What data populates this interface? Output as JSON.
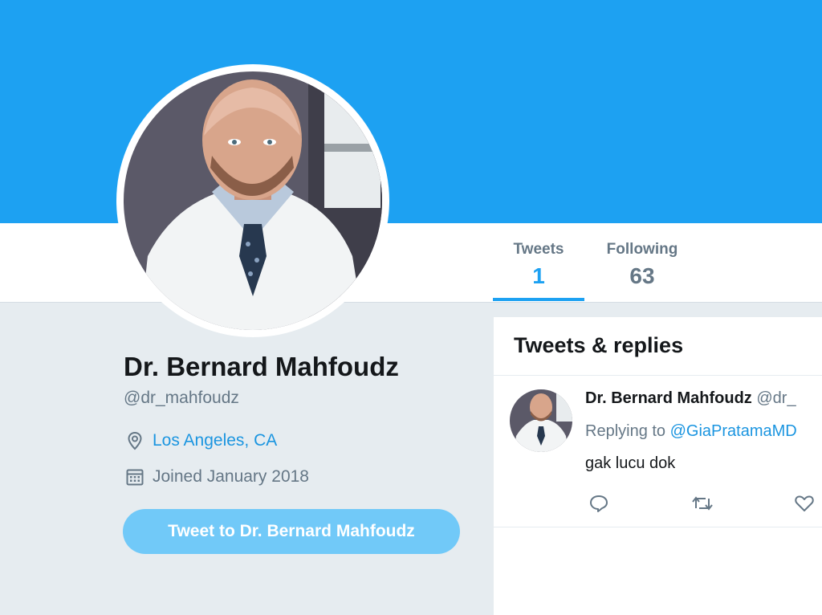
{
  "profile": {
    "name": "Dr. Bernard Mahfoudz",
    "handle": "@dr_mahfoudz",
    "location": "Los Angeles, CA",
    "joined": "Joined January 2018",
    "tweet_to_label": "Tweet to Dr. Bernard Mahfoudz"
  },
  "stats": {
    "tweets_label": "Tweets",
    "tweets_count": "1",
    "following_label": "Following",
    "following_count": "63"
  },
  "timeline": {
    "title": "Tweets & replies",
    "tweet": {
      "author_name": "Dr. Bernard Mahfoudz",
      "author_handle": "@dr_",
      "reply_prefix": "Replying to",
      "reply_mention": "@GiaPratamaMD",
      "text": "gak lucu dok",
      "actions": [
        "reply-icon",
        "retweet-icon",
        "like-icon"
      ]
    }
  },
  "colors": {
    "banner": "#1da1f2",
    "accent": "#1da1f2",
    "link": "#1b95e0",
    "button": "#71c9f8",
    "background": "#e6ecf0"
  },
  "icons": [
    "location-pin-icon",
    "calendar-icon"
  ]
}
